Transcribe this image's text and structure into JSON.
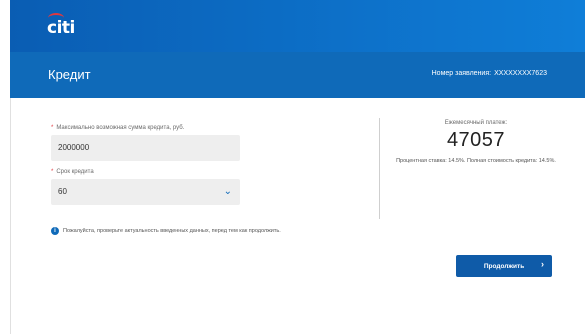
{
  "brand": {
    "logo_text": "citi"
  },
  "header": {
    "title": "Кредит",
    "application_label": "Номер заявления:",
    "application_number": "XXXXXXXX7623"
  },
  "form": {
    "amount": {
      "label": "Максимально возможная сумма кредита, руб.",
      "value": "2000000"
    },
    "term": {
      "label": "Срок кредита",
      "value": "60"
    },
    "note": "Пожалуйста, проверьте актуальность введенных данных, перед тем как продолжить."
  },
  "summary": {
    "monthly_label": "Ежемесячный платеж:",
    "monthly_value": "47057",
    "rate_text": "Процентная ставка: 14.5%. Полная стоимость кредита: 14.5%."
  },
  "actions": {
    "continue_label": "Продолжить"
  },
  "colors": {
    "primary": "#0f6ab9",
    "required": "#e0383e"
  }
}
